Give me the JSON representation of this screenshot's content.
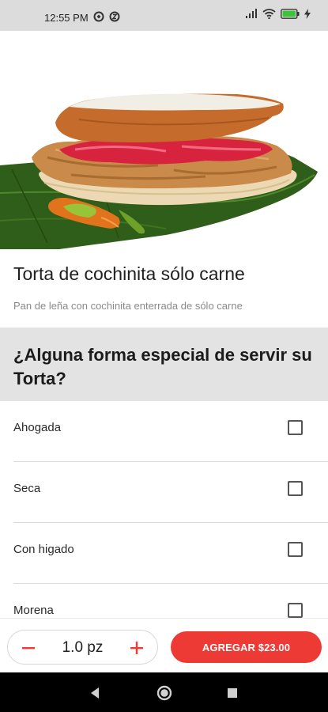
{
  "status_bar": {
    "time": "12:55 PM",
    "icons": [
      "notification-icon",
      "notification-icon",
      "signal-icon",
      "wifi-icon",
      "battery-icon",
      "charging-icon"
    ]
  },
  "product": {
    "title": "Torta de cochinita sólo carne",
    "description": "Pan de leña con cochinita enterrada de sólo carne"
  },
  "section": {
    "title": "¿Alguna forma especial de servir su Torta?"
  },
  "options": [
    {
      "label": "Ahogada",
      "checked": false
    },
    {
      "label": "Seca",
      "checked": false
    },
    {
      "label": "Con higado",
      "checked": false
    },
    {
      "label": "Morena",
      "checked": false
    }
  ],
  "quantity": {
    "value": "1.0 pz"
  },
  "add_button": {
    "label": "AGREGAR $23.00"
  },
  "colors": {
    "accent": "#ee3a34",
    "section_bg": "#e3e3e3",
    "status_bg": "#dcdcdc",
    "battery": "#3ec23a"
  },
  "navigation": {
    "icons": [
      "back-icon",
      "home-icon",
      "recents-icon"
    ]
  }
}
